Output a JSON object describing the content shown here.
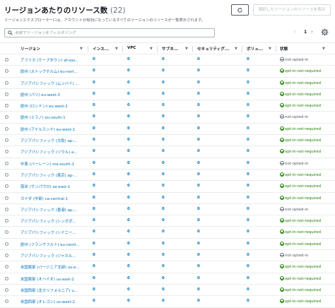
{
  "header": {
    "title": "リージョンあたりのリソース数",
    "count": "(22)",
    "subtitle": "リージョンエクスプローラーには、アカウントが有効になっているすべてのリージョンのリソースが一覧表示されます。",
    "refresh_icon": "refresh-icon",
    "view_button": "選択したリージョンのリソースを表示"
  },
  "search": {
    "placeholder": "名前でリージョンをフィルタリング",
    "value": ""
  },
  "pagination": {
    "prev": "‹",
    "page": "1",
    "next": "›"
  },
  "columns": [
    "リージョン",
    "インス...",
    "VPC",
    "サブネ...",
    "セキュリティグ...",
    "ボリュ...",
    "状態"
  ],
  "rows": [
    {
      "region": "アフリカ (ケープタウン) af-sou...",
      "instances": "0",
      "vpc": "0",
      "subnets": "0",
      "security_groups": "0",
      "volumes": "0",
      "status": "not-opted-in",
      "ok": false
    },
    {
      "region": "欧州 (ストックホルム) eu-nort...",
      "instances": "0",
      "vpc": "0",
      "subnets": "0",
      "security_groups": "0",
      "volumes": "0",
      "status": "opt-in-not-required",
      "ok": true
    },
    {
      "region": "アジアパシフィック (ムンバイ) ...",
      "instances": "0",
      "vpc": "0",
      "subnets": "0",
      "security_groups": "0",
      "volumes": "0",
      "status": "opt-in-not-required",
      "ok": true
    },
    {
      "region": "欧州 (パリ) eu-west-3",
      "instances": "0",
      "vpc": "0",
      "subnets": "0",
      "security_groups": "0",
      "volumes": "0",
      "status": "opt-in-not-required",
      "ok": true
    },
    {
      "region": "欧州 (ロンドン) eu-west-2",
      "instances": "0",
      "vpc": "0",
      "subnets": "0",
      "security_groups": "0",
      "volumes": "0",
      "status": "opt-in-not-required",
      "ok": true
    },
    {
      "region": "欧州 (ミラノ) eu-south-1",
      "instances": "0",
      "vpc": "0",
      "subnets": "0",
      "security_groups": "0",
      "volumes": "0",
      "status": "not-opted-in",
      "ok": false
    },
    {
      "region": "欧州 (アイルランド) eu-west-1",
      "instances": "0",
      "vpc": "0",
      "subnets": "0",
      "security_groups": "0",
      "volumes": "0",
      "status": "opt-in-not-required",
      "ok": true
    },
    {
      "region": "アジアパシフィック (大阪) ap-...",
      "instances": "0",
      "vpc": "0",
      "subnets": "0",
      "security_groups": "0",
      "volumes": "0",
      "status": "opt-in-not-required",
      "ok": true
    },
    {
      "region": "アジアパシフィック (ソウル) a...",
      "instances": "0",
      "vpc": "0",
      "subnets": "0",
      "security_groups": "0",
      "volumes": "0",
      "status": "opt-in-not-required",
      "ok": true
    },
    {
      "region": "中東 (バーレーン) me-south-1",
      "instances": "0",
      "vpc": "0",
      "subnets": "0",
      "security_groups": "0",
      "volumes": "0",
      "status": "not-opted-in",
      "ok": false
    },
    {
      "region": "アジアパシフィック (東京) ap-...",
      "instances": "0",
      "vpc": "0",
      "subnets": "0",
      "security_groups": "0",
      "volumes": "0",
      "status": "opt-in-not-required",
      "ok": true
    },
    {
      "region": "南米 (サンパウロ) sa-east-1",
      "instances": "0",
      "vpc": "0",
      "subnets": "0",
      "security_groups": "0",
      "volumes": "0",
      "status": "opt-in-not-required",
      "ok": true
    },
    {
      "region": "カナダ (中部) ca-central-1",
      "instances": "0",
      "vpc": "0",
      "subnets": "0",
      "security_groups": "0",
      "volumes": "0",
      "status": "opt-in-not-required",
      "ok": true
    },
    {
      "region": "アジアパシフィック (香港) ap-...",
      "instances": "0",
      "vpc": "0",
      "subnets": "0",
      "security_groups": "0",
      "volumes": "0",
      "status": "not-opted-in",
      "ok": false
    },
    {
      "region": "アジアパシフィック (シンガポ...",
      "instances": "0",
      "vpc": "0",
      "subnets": "0",
      "security_groups": "0",
      "volumes": "0",
      "status": "opt-in-not-required",
      "ok": true
    },
    {
      "region": "アジアパシフィック (シドニー...",
      "instances": "0",
      "vpc": "0",
      "subnets": "0",
      "security_groups": "0",
      "volumes": "0",
      "status": "opt-in-not-required",
      "ok": true
    },
    {
      "region": "欧州 (フランクフルト) eu-centr...",
      "instances": "0",
      "vpc": "0",
      "subnets": "0",
      "security_groups": "0",
      "volumes": "0",
      "status": "opt-in-not-required",
      "ok": true
    },
    {
      "region": "アジアパシフィック (ジャカル...",
      "instances": "0",
      "vpc": "0",
      "subnets": "0",
      "security_groups": "0",
      "volumes": "0",
      "status": "not-opted-in",
      "ok": false
    },
    {
      "region": "米国東部 (バージニア北部) us-e...",
      "instances": "0",
      "vpc": "0",
      "subnets": "0",
      "security_groups": "0",
      "volumes": "0",
      "status": "opt-in-not-required",
      "ok": true
    },
    {
      "region": "米国東部 (オハイオ) us-east-2",
      "instances": "0",
      "vpc": "0",
      "subnets": "0",
      "security_groups": "0",
      "volumes": "0",
      "status": "opt-in-not-required",
      "ok": true
    },
    {
      "region": "米国西部 (北カリフォルニア) u...",
      "instances": "0",
      "vpc": "0",
      "subnets": "0",
      "security_groups": "0",
      "volumes": "0",
      "status": "opt-in-not-required",
      "ok": true
    },
    {
      "region": "米国西部 (オレゴン) us-west-2",
      "instances": "0",
      "vpc": "0",
      "subnets": "0",
      "security_groups": "0",
      "volumes": "0",
      "status": "opt-in-not-required",
      "ok": true
    }
  ]
}
